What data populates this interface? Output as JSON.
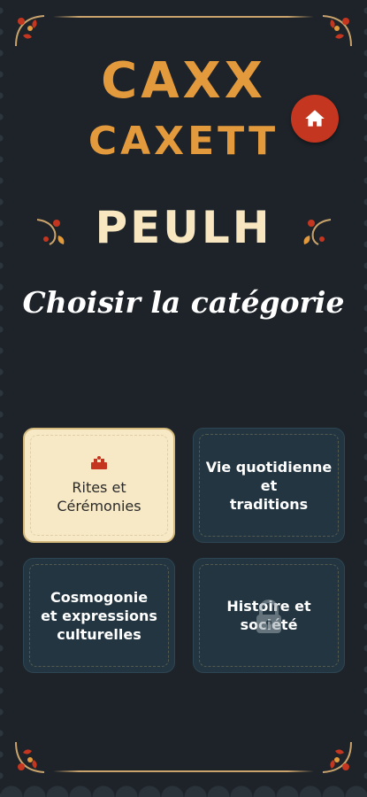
{
  "app": {
    "logo_line1": "CAXX",
    "logo_line2": "CAXETT",
    "language": "PEULH"
  },
  "screen": {
    "heading": "Choisir la catégorie"
  },
  "categories": [
    {
      "label": "Rites et\nCérémonies",
      "state": "selected",
      "icon": "ceremony-icon"
    },
    {
      "label": "Vie quotidienne et\ntraditions",
      "state": "default"
    },
    {
      "label": "Cosmogonie\net expressions\nculturelles",
      "state": "default"
    },
    {
      "label": "Histoire et\nsociété",
      "state": "locked",
      "icon": "lock-icon"
    }
  ],
  "colors": {
    "background": "#1d2329",
    "logo": "#e39a3c",
    "language": "#f7e6bf",
    "home_button": "#c4361f",
    "card_selected": "#f7e9c5",
    "card_default": "#233540"
  },
  "icons": {
    "home": "home-icon",
    "corner": "corner-ornament-icon",
    "ornament": "flourish-ornament-icon"
  }
}
